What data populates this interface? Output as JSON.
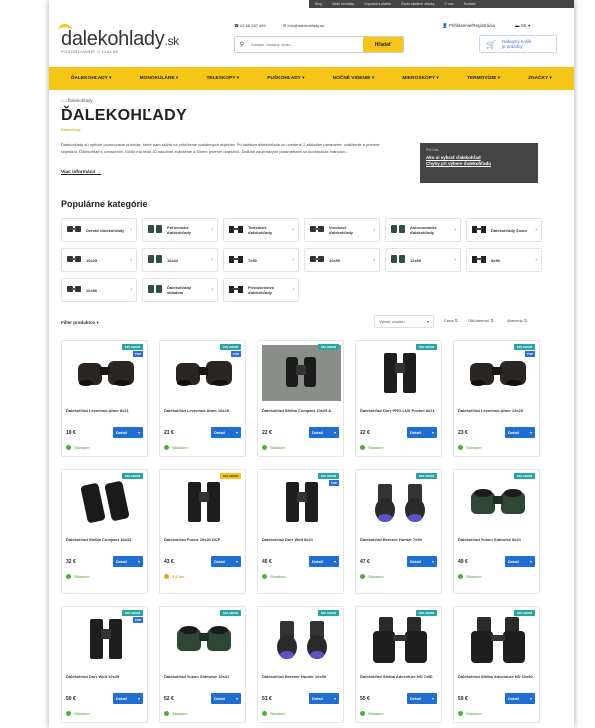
{
  "topbar": {
    "links": [
      "Blog",
      "Naše kontakty",
      "Doprava a platba",
      "Často kladené otázky",
      "O nás",
      "Kontakt"
    ]
  },
  "header": {
    "logo_text": "dalekohlady",
    "logo_tld": ".sk",
    "logo_tagline": "POZOROVANIE V DIAĽKE",
    "phone": "02 68 287 469",
    "email": "info@dalekohlady.sk",
    "search_placeholder": "Zadajte hľadaný výraz...",
    "search_button": "Hľadať",
    "login": "Prihlásenie/Registrácia",
    "lang": "SK",
    "cart_line1": "Nákupný košík",
    "cart_line2": "je prázdny"
  },
  "nav": {
    "items": [
      "ĎALEKOHĽADY",
      "MONOKULÁRE",
      "TELESKOPY",
      "PUŠKOHĽADY",
      "NOČNÉ VIDENIE",
      "MIKROSKOPY",
      "TERMOVÍZIE",
      "ZNAČKY"
    ]
  },
  "breadcrumb": {
    "current": "Ďalekohľady"
  },
  "page": {
    "title": "ĎALEKOHĽADY",
    "subtitle": "Ďalekohľady",
    "intro": "Ďalekohľady sú optické pozorovacie prístroje, ktoré nám slúžia na priblíženie vzdialených objektov. Pri každom ďalekohľade sú uvedené 2 základné parametre: zväčšenie a priemer objektívu. Ďalekohľad s označením 10x50 má teda 10-násobné zväčšenie a 50mm priemer objektívu. Ďalšími zaujímavými parametrami sú konštrukcia hranolov...",
    "more": "Viac informácií →",
    "tips_label": "Pre Vás",
    "tip1": "Ako si vybrať ďalekohľad",
    "tip2": "Chyby pri výbere ďalekohľadu"
  },
  "categories": {
    "heading": "Populárne kategórie",
    "items": [
      {
        "label": "Detské ďalekohľady"
      },
      {
        "label": "Poľovnícke ďalekohľady"
      },
      {
        "label": "Turistické ďalekohľady"
      },
      {
        "label": "Vreckové ďalekohľady"
      },
      {
        "label": "Astronomické ďalekohľady"
      },
      {
        "label": "Ďalekohľady Zoom"
      },
      {
        "label": "10x25"
      },
      {
        "label": "10x42"
      },
      {
        "label": "7x50"
      },
      {
        "label": "10x50"
      },
      {
        "label": "12x50"
      },
      {
        "label": "8x56"
      },
      {
        "label": "10x56"
      },
      {
        "label": "Ďalekohľady skladom"
      },
      {
        "label": "Príslušenstvo ďalekohľady"
      }
    ]
  },
  "filter": {
    "label": "Filter produktov",
    "sort_select": "Vybrať značku",
    "sort_price": "Cena",
    "sort_popular": "Obľúbenosť",
    "sort_abc": "Abecedy"
  },
  "products": [
    {
      "name": "Ďalekohľad Levenhuk Atom 8x21",
      "price": "19 €",
      "avail": "Skladom",
      "badge": "SKLADOM",
      "top": "TOP",
      "style": "compact"
    },
    {
      "name": "Ďalekohľad Levenhuk Atom 10x25",
      "price": "21 €",
      "avail": "Skladom",
      "badge": "SKLADOM",
      "top": "TOP",
      "style": "compact"
    },
    {
      "name": "Ďalekohľad Sfelba Compact 10x25 A",
      "price": "22 €",
      "avail": "Skladom",
      "badge": "SKLADOM",
      "top": "",
      "style": "photo"
    },
    {
      "name": "Ďalekohľad Dorr PRO-LUX Pocket 8x21",
      "price": "22 €",
      "avail": "Skladom",
      "badge": "SKLADOM",
      "top": "",
      "style": "roof"
    },
    {
      "name": "Ďalekohľad Levenhuk Atom 12x25",
      "price": "23 €",
      "avail": "Skladom",
      "badge": "SKLADOM",
      "top": "TOP",
      "style": "compact"
    },
    {
      "name": "Ďalekohľad Sfelba Compact 16x32",
      "price": "32 €",
      "avail": "Skladom",
      "badge": "SKLADOM",
      "top": "",
      "style": "roofbig"
    },
    {
      "name": "Ďalekohľad Focus 10x26 DCF",
      "price": "43 €",
      "avail": "3-5 dní",
      "badge": "SKLADOM",
      "top": "",
      "style": "roof"
    },
    {
      "name": "Ďalekohľad Dorr Wolf 8x21",
      "price": "45 €",
      "avail": "Skladom",
      "badge": "SKLADOM",
      "top": "TOP",
      "style": "roof"
    },
    {
      "name": "Ďalekohľad Bresser Hunter 7x50",
      "price": "47 €",
      "avail": "Skladom",
      "badge": "SKLADOM",
      "top": "",
      "style": "porro"
    },
    {
      "name": "Ďalekohľad Yukon Sidewise 8x21",
      "price": "49 €",
      "avail": "Skladom",
      "badge": "SKLADOM",
      "top": "",
      "style": "green"
    },
    {
      "name": "Ďalekohľad Dorr Wolf 10x25",
      "price": "50 €",
      "avail": "Skladom",
      "badge": "SKLADOM",
      "top": "TOP",
      "style": "roof"
    },
    {
      "name": "Ďalekohľad Yukon Sidewise 10x21",
      "price": "52 €",
      "avail": "Skladom",
      "badge": "SKLADOM",
      "top": "",
      "style": "green"
    },
    {
      "name": "Ďalekohľad Bresser Hunter 10x50",
      "price": "53 €",
      "avail": "Skladom",
      "badge": "SKLADOM",
      "top": "",
      "style": "porro"
    },
    {
      "name": "Ďalekohľad Sfelba Adventure HD 7x50",
      "price": "55 €",
      "avail": "Skladom",
      "badge": "SKLADOM",
      "top": "",
      "style": "porrobig"
    },
    {
      "name": "Ďalekohľad Sfelba Adventure HD 10x50",
      "price": "59 €",
      "avail": "Skladom",
      "badge": "SKLADOM",
      "top": "",
      "style": "porrobig"
    }
  ],
  "detail_label": "Detail",
  "colors": {
    "accent": "#f5c518",
    "button": "#1f6fd2",
    "badge": "#2aa5a5",
    "stock": "#4caf37"
  }
}
